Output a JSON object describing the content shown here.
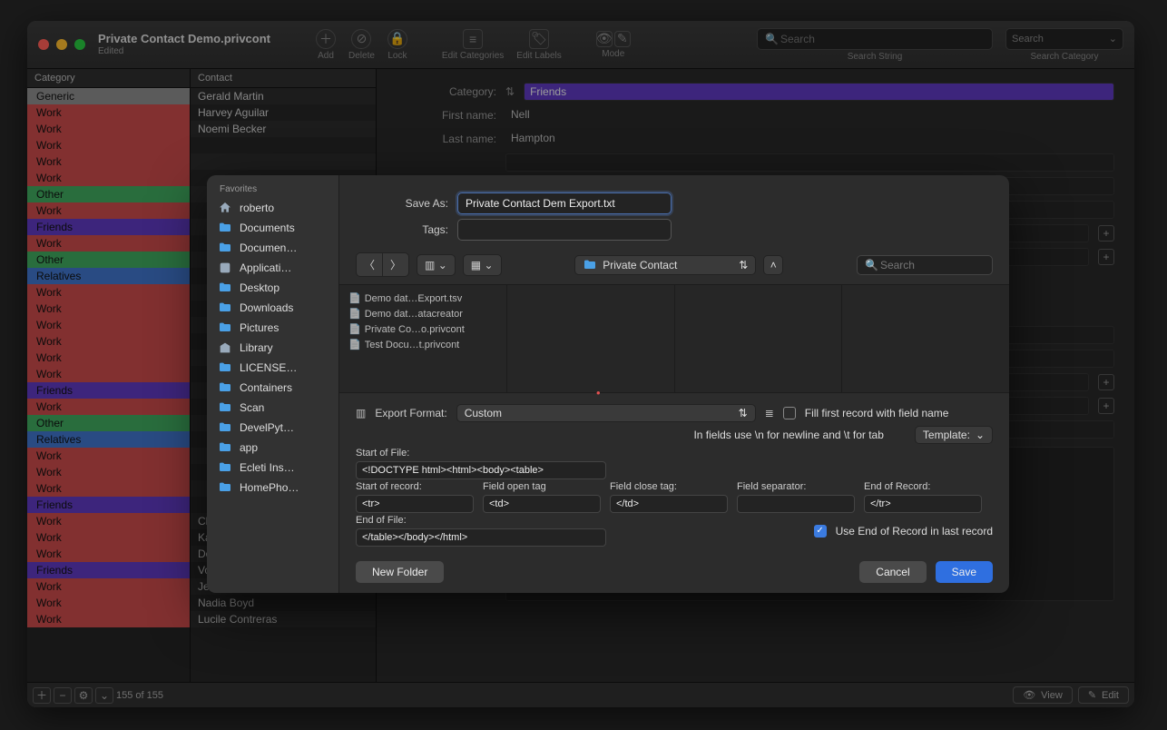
{
  "window": {
    "title": "Private Contact Demo.privcont",
    "subtitle": "Edited"
  },
  "toolbar": {
    "add": "Add",
    "delete": "Delete",
    "lock": "Lock",
    "edit_categories": "Edit Categories",
    "edit_labels": "Edit Labels",
    "mode": "Mode",
    "search_placeholder": "Search",
    "search_string_label": "Search String",
    "search_category_label": "Search Category",
    "search_cat_placeholder": "Search"
  },
  "headers": {
    "category": "Category",
    "contact": "Contact"
  },
  "categories": [
    {
      "label": "Generic",
      "color": "#8d8d8d"
    },
    {
      "label": "Work",
      "color": "#c84a4a"
    },
    {
      "label": "Work",
      "color": "#c84a4a"
    },
    {
      "label": "Work",
      "color": "#c84a4a"
    },
    {
      "label": "Work",
      "color": "#c84a4a"
    },
    {
      "label": "Work",
      "color": "#c84a4a"
    },
    {
      "label": "Other",
      "color": "#3fa85f"
    },
    {
      "label": "Work",
      "color": "#c84a4a"
    },
    {
      "label": "Friends",
      "color": "#5e3abf"
    },
    {
      "label": "Work",
      "color": "#c84a4a"
    },
    {
      "label": "Other",
      "color": "#3fa85f"
    },
    {
      "label": "Relatives",
      "color": "#3f74c9"
    },
    {
      "label": "Work",
      "color": "#c84a4a"
    },
    {
      "label": "Work",
      "color": "#c84a4a"
    },
    {
      "label": "Work",
      "color": "#c84a4a"
    },
    {
      "label": "Work",
      "color": "#c84a4a"
    },
    {
      "label": "Work",
      "color": "#c84a4a"
    },
    {
      "label": "Work",
      "color": "#c84a4a"
    },
    {
      "label": "Friends",
      "color": "#5e3abf"
    },
    {
      "label": "Work",
      "color": "#c84a4a"
    },
    {
      "label": "Other",
      "color": "#3fa85f"
    },
    {
      "label": "Relatives",
      "color": "#3f74c9"
    },
    {
      "label": "Work",
      "color": "#c84a4a"
    },
    {
      "label": "Work",
      "color": "#c84a4a"
    },
    {
      "label": "Work",
      "color": "#c84a4a"
    },
    {
      "label": "Friends",
      "color": "#5e3abf"
    },
    {
      "label": "Work",
      "color": "#c84a4a"
    },
    {
      "label": "Work",
      "color": "#c84a4a"
    },
    {
      "label": "Work",
      "color": "#c84a4a"
    },
    {
      "label": "Friends",
      "color": "#5e3abf"
    },
    {
      "label": "Work",
      "color": "#c84a4a"
    },
    {
      "label": "Work",
      "color": "#c84a4a"
    },
    {
      "label": "Work",
      "color": "#c84a4a"
    }
  ],
  "contacts": [
    "Gerald Martin",
    "Harvey Aguilar",
    "Noemi Becker",
    "",
    "",
    "",
    "",
    "",
    "",
    "",
    "",
    "",
    "",
    "",
    "",
    "",
    "",
    "",
    "",
    "",
    "",
    "",
    "",
    "",
    "",
    "",
    "Cheri Mercado",
    "Karina Montoya",
    "Dorothy Freeman",
    "Vonda Berg",
    "Jessie Bowman",
    "Nadia Boyd",
    "Lucile Contreras"
  ],
  "detail": {
    "category_label": "Category:",
    "category_value": "Friends",
    "first_label": "First name:",
    "first_value": "Nell",
    "last_label": "Last name:",
    "last_value": "Hampton"
  },
  "footer": {
    "count": "155 of 155",
    "view": "View",
    "edit": "Edit"
  },
  "sheet": {
    "save_as_label": "Save As:",
    "save_as_value": "Private Contact Dem Export.txt",
    "tags_label": "Tags:",
    "tags_value": "",
    "favorites_header": "Favorites",
    "sidebar": [
      {
        "icon": "home",
        "label": "roberto"
      },
      {
        "icon": "folder",
        "label": "Documents"
      },
      {
        "icon": "folder",
        "label": "Documen…"
      },
      {
        "icon": "app",
        "label": "Applicati…"
      },
      {
        "icon": "folder",
        "label": "Desktop"
      },
      {
        "icon": "folder",
        "label": "Downloads"
      },
      {
        "icon": "folder",
        "label": "Pictures"
      },
      {
        "icon": "library",
        "label": "Library"
      },
      {
        "icon": "folder",
        "label": "LICENSE…"
      },
      {
        "icon": "folder",
        "label": "Containers"
      },
      {
        "icon": "folder",
        "label": "Scan"
      },
      {
        "icon": "folder",
        "label": "DevelPyt…"
      },
      {
        "icon": "folder",
        "label": "app"
      },
      {
        "icon": "folder",
        "label": "Ecleti Ins…"
      },
      {
        "icon": "folder",
        "label": "HomePho…"
      }
    ],
    "location": "Private Contact",
    "search_placeholder": "Search",
    "files": [
      "Demo dat…Export.tsv",
      "Demo dat…atacreator",
      "Private Co…o.privcont",
      "Test Docu…t.privcont"
    ],
    "export_format_label": "Export Format:",
    "export_format_value": "Custom",
    "fill_first_label": "Fill first record with field name",
    "hint": "In fields use \\n for newline and \\t for tab",
    "template_label": "Template:",
    "start_file_label": "Start of File:",
    "start_file_value": "<!DOCTYPE html><html><body><table>",
    "start_record_label": "Start of record:",
    "start_record_value": "<tr>",
    "field_open_label": "Field open tag",
    "field_open_value": "<td>",
    "field_close_label": "Field close tag:",
    "field_close_value": "</td>",
    "field_sep_label": "Field separator:",
    "field_sep_value": "",
    "end_record_label": "End of Record:",
    "end_record_value": "</tr>",
    "end_file_label": "End of File:",
    "end_file_value": "</table></body></html>",
    "use_end_label": "Use End of Record in last record",
    "new_folder": "New Folder",
    "cancel": "Cancel",
    "save": "Save"
  }
}
